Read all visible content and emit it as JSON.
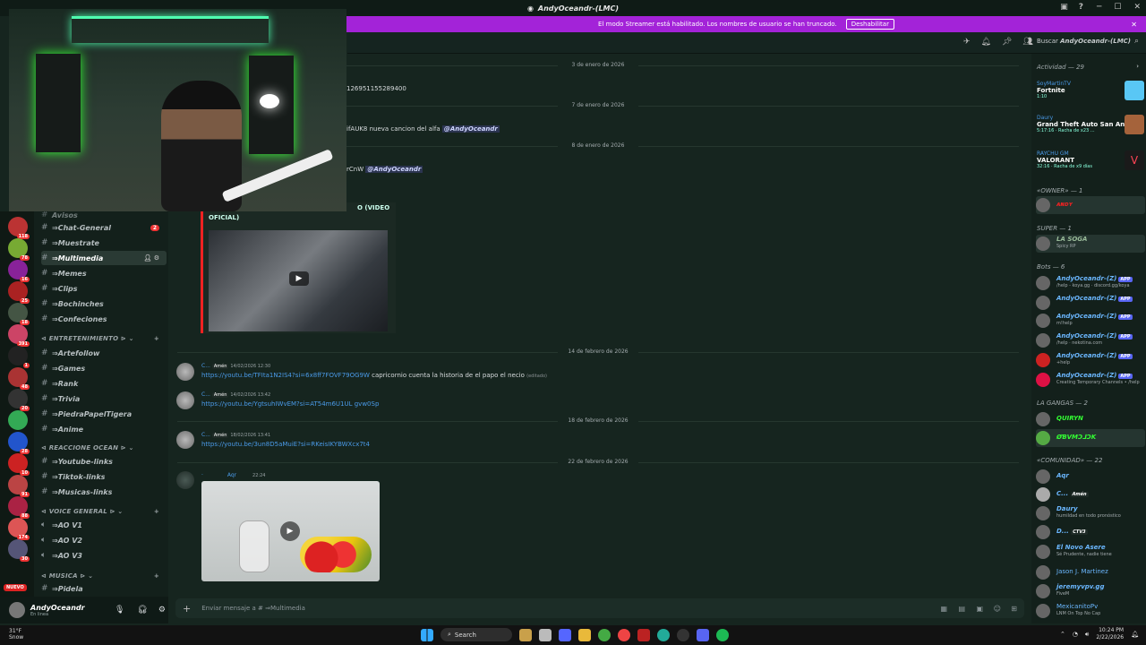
{
  "window": {
    "title": "AndyOceandr-(LMC)"
  },
  "streamer_banner": {
    "text": "El modo Streamer está habilitado. Los nombres de usuario se han truncado.",
    "button": "Deshabilitar"
  },
  "topbar": {
    "search_label": "Buscar",
    "search_server": "AndyOceandr-(LMC)"
  },
  "channels": {
    "header_partial": "Avisos",
    "items": [
      {
        "name": "Chat-General",
        "badge": "2"
      },
      {
        "name": "Muestrate"
      },
      {
        "name": "Multimedia",
        "active": true
      },
      {
        "name": "Memes"
      },
      {
        "name": "Clips"
      },
      {
        "name": "Bochinches"
      },
      {
        "name": "Confeciones"
      }
    ],
    "cat_ent": "ENTRETENIMIENTO",
    "ent_items": [
      "Artefollow",
      "Games",
      "Rank",
      "Trivia",
      "PiedraPapelTigera",
      "Anime"
    ],
    "cat_reac": "REACCIONE OCEAN",
    "reac_items": [
      "Youtube-links",
      "Tiktok-links",
      "Musicas-links"
    ],
    "cat_voz": "VOICE GENERAL",
    "voz_items": [
      "AO V1",
      "AO V2",
      "AO V3"
    ],
    "cat_music": "MUSICA",
    "music_items": [
      "Pidela"
    ]
  },
  "user_panel": {
    "name": "AndyOceandr",
    "status": "En linea"
  },
  "chat": {
    "dates": [
      "3 de enero de 2026",
      "7 de enero de 2026",
      "8 de enero de 2026",
      "14 de febrero de 2026",
      "18 de febrero de 2026",
      "22 de febrero de 2026"
    ],
    "msg1": "126951155289400",
    "msg2_pre": "ifAUK8 nueva cancion del alfa",
    "msg2_mention": "@AndyOceandr",
    "msg3_pre": "rCnW",
    "msg3_mention": "@AndyOceandr",
    "embed_title_a": "O (VIDEO",
    "embed_title_b": "OFICIAL)",
    "m4_user": "C...",
    "m4_role": "Amén",
    "m4_time": "14/02/2026 12:30",
    "m4_link": "https://youtu.be/TFIta1N2IS4?si=6x8ff7FOVF79OG9W",
    "m4_text": "capricornio cuenta la historia de el papo el necio",
    "m4_edited": "(editado)",
    "m5_user": "C...",
    "m5_role": "Amén",
    "m5_time": "14/02/2026 13:42",
    "m5_link": "https://youtu.be/YgtsuhIWvEM?si=AT54m6U1UL gvw0Sp",
    "m6_user": "C...",
    "m6_role": "Amén",
    "m6_time": "18/02/2026 13:41",
    "m6_link": "https://youtu.be/3un8D5aMuiE?si=RKeisIKYBWXcx7t4",
    "m7_user": "Aqr",
    "m7_time": "22:24",
    "composer_placeholder": "Enviar mensaje a # ⇒Multimedia"
  },
  "members": {
    "activity_header": "Actividad — 29",
    "activities": [
      {
        "user": "SoyMartinTV",
        "game": "Fortnite",
        "detail": "1:10"
      },
      {
        "user": "Daury",
        "game": "Grand Theft Auto San Andr...",
        "detail": "5:17:16 · Racha de x23 ..."
      },
      {
        "user": "RAYCHU GM",
        "game": "VALORANT",
        "detail": "32:16 · Racha de x9 días"
      }
    ],
    "owner_header": "«OWNER» — 1",
    "super_header": "SUPER — 1",
    "super_member": "LA SOGA",
    "super_status": "Spicy RP",
    "bots_header": "Bots — 6",
    "bots": [
      {
        "name": "AndyOceandr-(Z)",
        "status": "/help - koya.gg · discord.gg/koya"
      },
      {
        "name": "AndyOceandr-(Z)",
        "status": ""
      },
      {
        "name": "AndyOceandr-(Z)",
        "status": "m!help"
      },
      {
        "name": "AndyOceandr-(Z)",
        "status": "/help · nekotina.com"
      },
      {
        "name": "AndyOceandr-(Z)",
        "status": "+help"
      },
      {
        "name": "AndyOceandr-(Z)",
        "status": "Creating Temporary Channels • /help"
      }
    ],
    "app_label": "APP",
    "gangas_header": "LA GANGAS — 2",
    "gangas": [
      "QUIRYN",
      "ØƁVMƆ⅃ƆK"
    ],
    "com_header": "«COMUNIDAD» — 22",
    "community": [
      {
        "name": "Aqr",
        "status": ""
      },
      {
        "name": "C...",
        "status": "Amén"
      },
      {
        "name": "Daury",
        "status": "humildad en todo pronóstico"
      },
      {
        "name": "D...",
        "status": "CTV3"
      },
      {
        "name": "El Novo Asere",
        "status": "Sé Prudente, nadie tiene"
      },
      {
        "name": "Jason J. Martinez",
        "status": ""
      },
      {
        "name": "jeremyvpv.gg",
        "status": "FiveM"
      },
      {
        "name": "MexicanitoPv",
        "status": "LNM On Top No Cap"
      }
    ]
  },
  "taskbar": {
    "weather_temp": "31°F",
    "weather_desc": "Snow",
    "search": "Search",
    "time": "10:24 PM",
    "date": "2/22/2026",
    "news": "NUEVO"
  }
}
